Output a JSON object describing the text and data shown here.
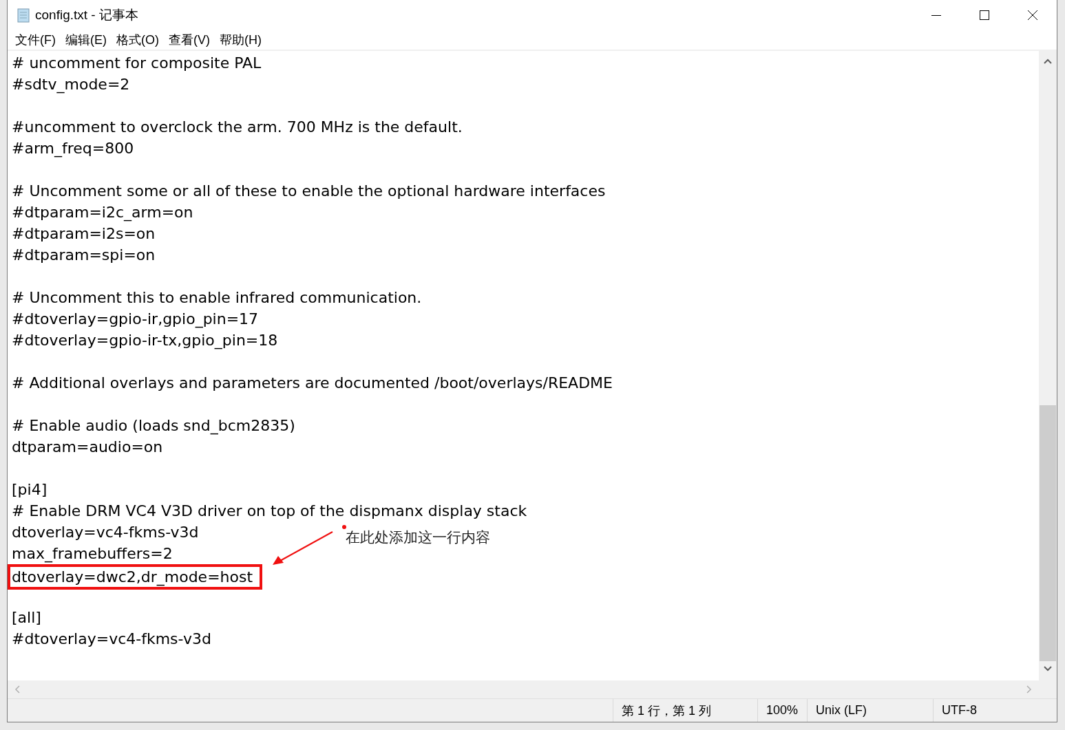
{
  "window": {
    "title": "config.txt - 记事本"
  },
  "menu": [
    {
      "label": "文件(F)"
    },
    {
      "label": "编辑(E)"
    },
    {
      "label": "格式(O)"
    },
    {
      "label": "查看(V)"
    },
    {
      "label": "帮助(H)"
    }
  ],
  "lines": [
    {
      "kind": "text",
      "text": "# uncomment for composite PAL",
      "highlighted": false
    },
    {
      "kind": "text",
      "text": "#sdtv_mode=2",
      "highlighted": false
    },
    {
      "kind": "blank"
    },
    {
      "kind": "text",
      "text": "#uncomment to overclock the arm. 700 MHz is the default.",
      "highlighted": false
    },
    {
      "kind": "text",
      "text": "#arm_freq=800",
      "highlighted": false
    },
    {
      "kind": "blank"
    },
    {
      "kind": "text",
      "text": "# Uncomment some or all of these to enable the optional hardware interfaces",
      "highlighted": false
    },
    {
      "kind": "text",
      "text": "#dtparam=i2c_arm=on",
      "highlighted": false
    },
    {
      "kind": "text",
      "text": "#dtparam=i2s=on",
      "highlighted": false
    },
    {
      "kind": "text",
      "text": "#dtparam=spi=on",
      "highlighted": false
    },
    {
      "kind": "blank"
    },
    {
      "kind": "text",
      "text": "# Uncomment this to enable infrared communication.",
      "highlighted": false
    },
    {
      "kind": "text",
      "text": "#dtoverlay=gpio-ir,gpio_pin=17",
      "highlighted": false
    },
    {
      "kind": "text",
      "text": "#dtoverlay=gpio-ir-tx,gpio_pin=18",
      "highlighted": false
    },
    {
      "kind": "blank"
    },
    {
      "kind": "text",
      "text": "# Additional overlays and parameters are documented /boot/overlays/README",
      "highlighted": false
    },
    {
      "kind": "blank"
    },
    {
      "kind": "text",
      "text": "# Enable audio (loads snd_bcm2835)",
      "highlighted": false
    },
    {
      "kind": "text",
      "text": "dtparam=audio=on",
      "highlighted": false
    },
    {
      "kind": "blank"
    },
    {
      "kind": "text",
      "text": "[pi4]",
      "highlighted": false
    },
    {
      "kind": "text",
      "text": "# Enable DRM VC4 V3D driver on top of the dispmanx display stack",
      "highlighted": false
    },
    {
      "kind": "text",
      "text": "dtoverlay=vc4-fkms-v3d",
      "highlighted": false
    },
    {
      "kind": "text",
      "text": "max_framebuffers=2",
      "highlighted": false
    },
    {
      "kind": "text",
      "text": "dtoverlay=dwc2,dr_mode=host",
      "highlighted": true
    },
    {
      "kind": "blank"
    },
    {
      "kind": "text",
      "text": "[all]",
      "highlighted": false
    },
    {
      "kind": "text",
      "text": "#dtoverlay=vc4-fkms-v3d",
      "highlighted": false
    }
  ],
  "annotation": {
    "text": "在此处添加这一行内容"
  },
  "status_bar": [
    {
      "text": "第 1 行，第 1 列"
    },
    {
      "text": "100%"
    },
    {
      "text": "Unix (LF)"
    },
    {
      "text": "UTF-8"
    }
  ]
}
